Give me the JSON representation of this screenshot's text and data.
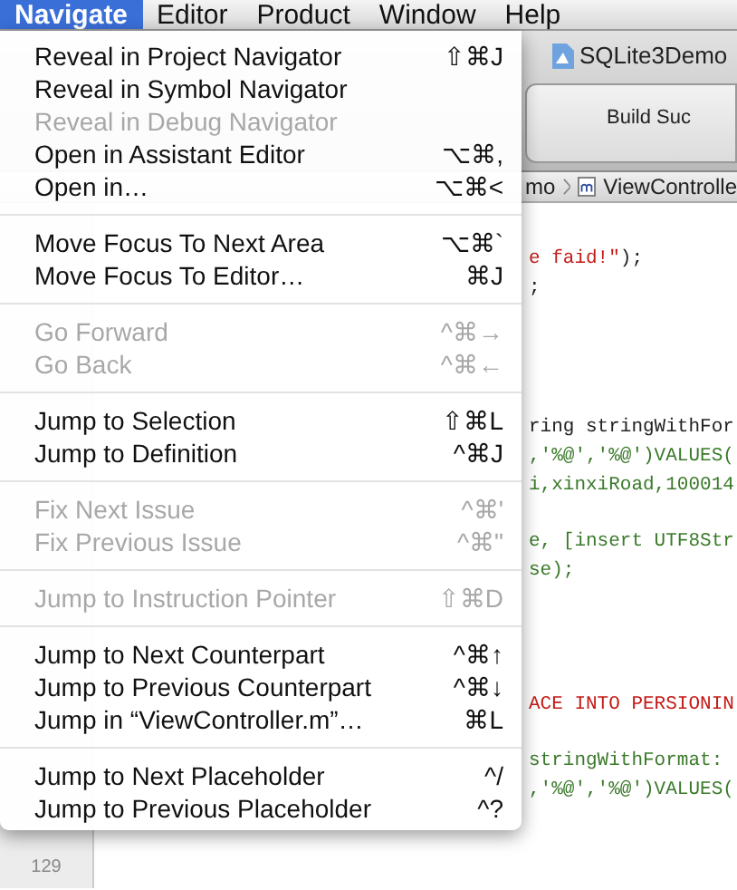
{
  "menubar": [
    {
      "label": "Navigate",
      "selected": true
    },
    {
      "label": "Editor",
      "selected": false
    },
    {
      "label": "Product",
      "selected": false
    },
    {
      "label": "Window",
      "selected": false
    },
    {
      "label": "Help",
      "selected": false
    }
  ],
  "menu": {
    "sections": [
      [
        {
          "label": "Reveal in Project Navigator",
          "shortcut": "⇧⌘J",
          "disabled": false
        },
        {
          "label": "Reveal in Symbol Navigator",
          "disabled": false
        },
        {
          "label": "Reveal in Debug Navigator",
          "disabled": true
        },
        {
          "label": "Open in Assistant Editor",
          "shortcut": "⌥⌘,",
          "disabled": false
        },
        {
          "label": "Open in…",
          "shortcut": "⌥⌘<",
          "disabled": false
        }
      ],
      [
        {
          "label": "Move Focus To Next Area",
          "shortcut": "⌥⌘`",
          "disabled": false
        },
        {
          "label": "Move Focus To Editor…",
          "shortcut": "⌘J",
          "disabled": false
        }
      ],
      [
        {
          "label": "Go Forward",
          "shortcut": "^⌘→",
          "disabled": true
        },
        {
          "label": "Go Back",
          "shortcut": "^⌘←",
          "disabled": true
        }
      ],
      [
        {
          "label": "Jump to Selection",
          "shortcut": "⇧⌘L",
          "disabled": false
        },
        {
          "label": "Jump to Definition",
          "shortcut": "^⌘J",
          "disabled": false
        }
      ],
      [
        {
          "label": "Fix Next Issue",
          "shortcut": "^⌘'",
          "disabled": true
        },
        {
          "label": "Fix Previous Issue",
          "shortcut": "^⌘\"",
          "disabled": true
        }
      ],
      [
        {
          "label": "Jump to Instruction Pointer",
          "shortcut": "⇧⌘D",
          "disabled": true
        }
      ],
      [
        {
          "label": "Jump to Next Counterpart",
          "shortcut": "^⌘↑",
          "disabled": false
        },
        {
          "label": "Jump to Previous Counterpart",
          "shortcut": "^⌘↓",
          "disabled": false
        },
        {
          "label": "Jump in “ViewController.m”…",
          "shortcut": "⌘L",
          "disabled": false
        }
      ],
      [
        {
          "label": "Jump to Next Placeholder",
          "shortcut": "^/",
          "disabled": false
        },
        {
          "label": "Jump to Previous Placeholder",
          "shortcut": "^?",
          "disabled": false
        }
      ]
    ]
  },
  "window": {
    "title": "SQLite3Demo",
    "activity": "Build Suc",
    "breadcrumb": [
      "mo",
      "ViewControlle"
    ]
  },
  "code": {
    "lines": [
      [
        {
          "text": "e faid!\"",
          "kind": "string"
        },
        {
          "text": ");",
          "kind": "plain"
        }
      ],
      [
        {
          "text": ";",
          "kind": "plain"
        }
      ],
      [
        {
          "text": "ring stringWithFor",
          "kind": "plain"
        }
      ],
      [
        {
          "text": ",'%@','%@')VALUES(",
          "kind": "comment"
        }
      ],
      [
        {
          "text": "i,xinxiRoad,100014",
          "kind": "comment"
        }
      ],
      [
        {
          "text": "e, [insert UTF8Str",
          "kind": "comment"
        }
      ],
      [
        {
          "text": "se);",
          "kind": "comment"
        }
      ],
      [
        {
          "text": "ACE INTO PERSIONIN",
          "kind": "string"
        }
      ],
      [
        {
          "text": "stringWithFormat:",
          "kind": "comment"
        }
      ],
      [
        {
          "text": ",'%@','%@')VALUES(",
          "kind": "comment"
        }
      ]
    ],
    "line_number": "129"
  }
}
